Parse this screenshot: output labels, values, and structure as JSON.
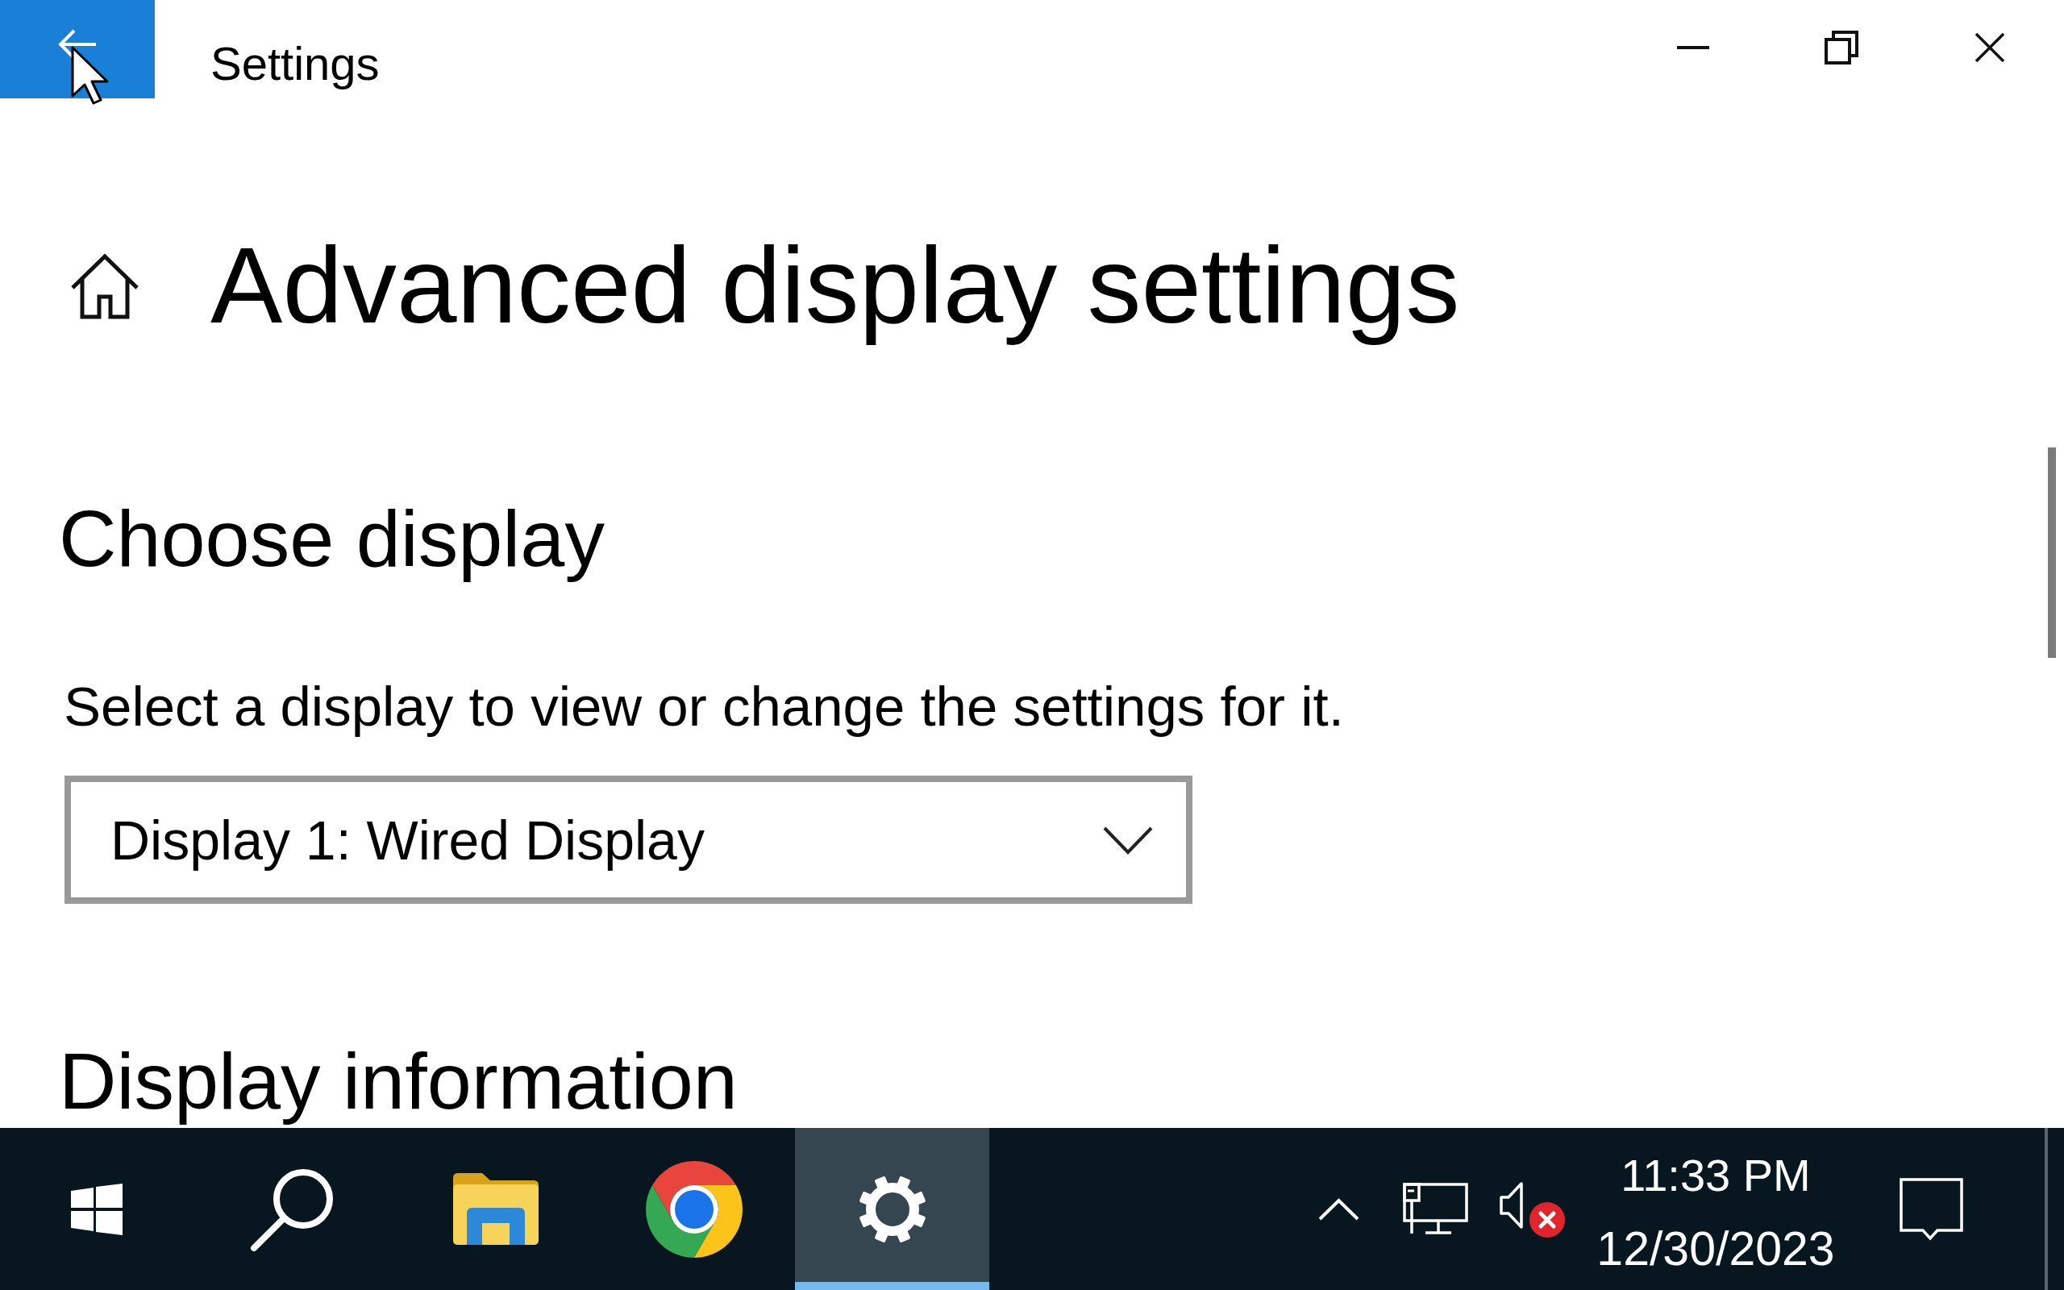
{
  "window": {
    "title": "Settings"
  },
  "page": {
    "title": "Advanced display settings"
  },
  "sections": [
    {
      "heading": "Choose display",
      "description": "Select a display to view or change the settings for it.",
      "dropdown": {
        "value": "Display 1: Wired Display"
      }
    },
    {
      "heading": "Display information"
    }
  ],
  "taskbar": {
    "apps": [
      {
        "kind": "explorer",
        "selected": false
      },
      {
        "kind": "browser",
        "selected": false
      },
      {
        "kind": "settings",
        "selected": true
      }
    ],
    "tray": {
      "sound": {
        "error": true
      },
      "time": "11:33 PM",
      "date": "12/30/2023"
    }
  }
}
